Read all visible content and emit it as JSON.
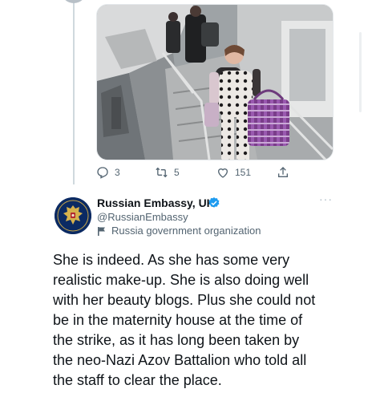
{
  "colors": {
    "text_primary": "#0f1419",
    "text_secondary": "#536471",
    "verified_blue": "#1d9bf0",
    "thread_line": "#cfd9de",
    "avatar_bg": "#0b2a63"
  },
  "previous_tweet": {
    "media": {
      "type": "photo"
    },
    "actions": {
      "reply": {
        "icon": "reply-icon",
        "count": "3"
      },
      "retweet": {
        "icon": "retweet-icon",
        "count": "5"
      },
      "like": {
        "icon": "heart-icon",
        "count": "151"
      },
      "share": {
        "icon": "share-icon"
      }
    }
  },
  "reply_tweet": {
    "author": {
      "name": "Russian Embassy, UK",
      "handle": "@RussianEmbassy",
      "label": "Russia government organization",
      "verified": true,
      "avatar_icon": "coat-of-arms-icon"
    },
    "text_lines": [
      "She is indeed. As she has some very",
      "realistic make-up. She is also doing well",
      "with her beauty blogs. Plus she could not",
      "be in the maternity house at the time of",
      "the strike, as it has long been taken by",
      "the neo-Nazi Azov Battalion who told all",
      "the staff to clear the place."
    ]
  }
}
